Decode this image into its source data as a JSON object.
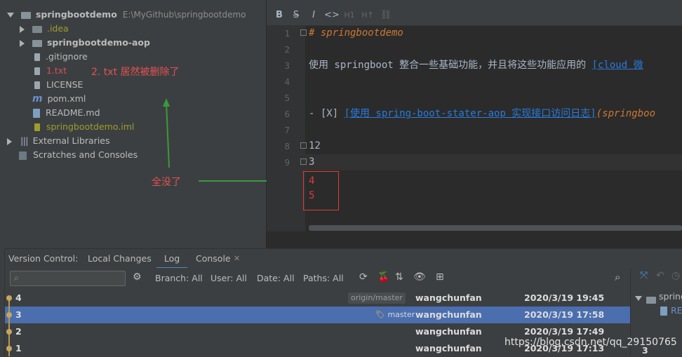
{
  "project": {
    "root_name": "springbootdemo",
    "root_path": "E:\\MyGithub\\springbootdemo",
    "items": [
      {
        "label": ".idea"
      },
      {
        "label": "springbootdemo-aop"
      },
      {
        "label": ".gitignore"
      },
      {
        "label": "1.txt"
      },
      {
        "label": "LICENSE"
      },
      {
        "label": "pom.xml"
      },
      {
        "label": "README.md"
      },
      {
        "label": "springbootdemo.iml"
      },
      {
        "label": "External Libraries"
      },
      {
        "label": "Scratches and Consoles"
      }
    ],
    "annotation_deleted": "2. txt 居然被删除了",
    "annotation_all_gone": "全没了"
  },
  "editor": {
    "toolbar": [
      "B",
      "S",
      "I",
      "<>",
      "H1",
      "H↑",
      "link"
    ],
    "line_numbers": [
      "1",
      "2",
      "3",
      "4",
      "5",
      "6",
      "7",
      "8",
      "9"
    ],
    "line1": "# springbootdemo",
    "line3_text": "使用 springboot 整合一些基础功能，并且将这些功能应用的 ",
    "line3_link": "[cloud 微",
    "line6_prefix": "- [X] ",
    "line6_link": "[使用 spring-boot-stater-aop 实现接口访问日志]",
    "line6_url": "(springboo",
    "line8": "12",
    "line9": "3",
    "extra_line_a": "4",
    "extra_line_b": "5"
  },
  "bottom": {
    "vc_label": "Version Control:",
    "tabs": [
      "Local Changes",
      "Log",
      "Console"
    ],
    "filters": {
      "branch": "Branch: All",
      "user": "User: All",
      "date": "Date: All",
      "paths": "Paths: All"
    },
    "log": [
      {
        "msg": "4",
        "ref": "origin/master",
        "author": "wangchunfan",
        "date": "2020/3/19 19:45"
      },
      {
        "msg": "3",
        "ref": "master",
        "author": "wangchunfan",
        "date": "2020/3/19 17:58"
      },
      {
        "msg": "2",
        "ref": "",
        "author": "wangchunfan",
        "date": "2020/3/19 17:49"
      },
      {
        "msg": "1",
        "ref": "",
        "author": "wangchunfan",
        "date": "2020/3/19 17:13"
      }
    ],
    "right_panel_item": "spring",
    "right_panel_sub": "RE",
    "right_panel_num": "3"
  },
  "watermark": "https://blog.csdn.net/qq_29150765",
  "colors": {
    "accent_selected": "#4b6eaf",
    "annotation": "#e35252",
    "arrow": "#3a9a3a"
  }
}
